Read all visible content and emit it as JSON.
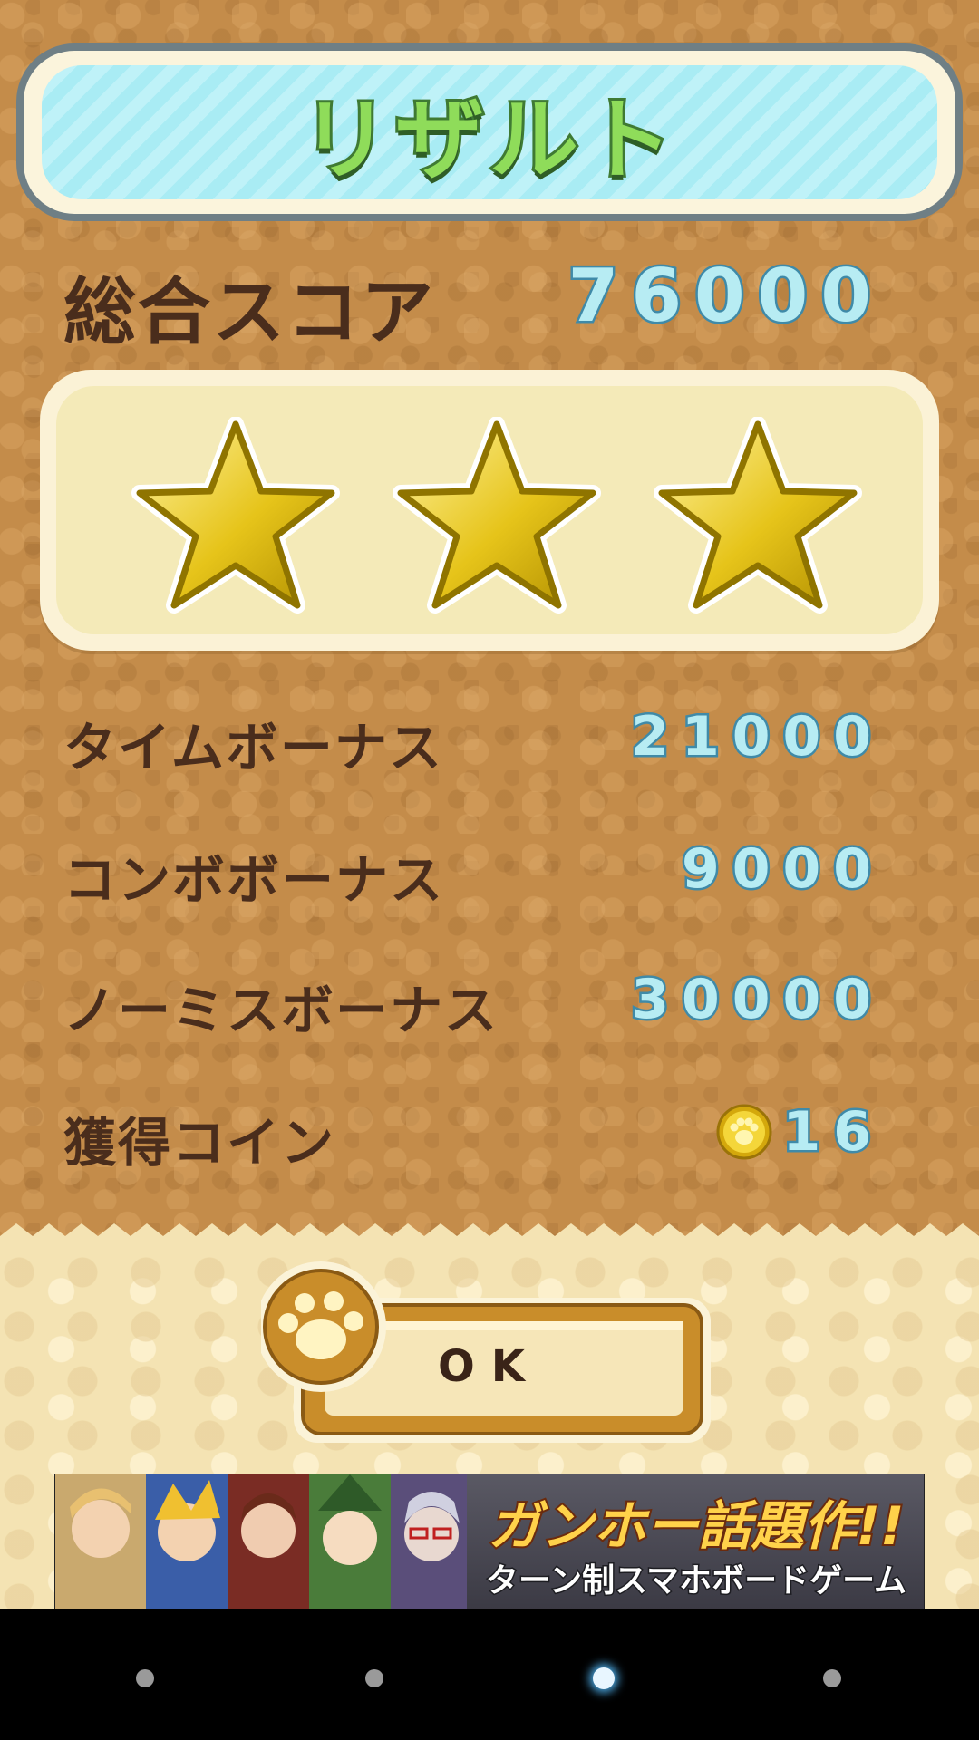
{
  "title": "リザルト",
  "total_score": {
    "label": "総合スコア",
    "value": "76000"
  },
  "stars": {
    "earned": 3,
    "total": 3
  },
  "bonuses": [
    {
      "label": "タイムボーナス",
      "value": "21000"
    },
    {
      "label": "コンボボーナス",
      "value": "9000"
    },
    {
      "label": "ノーミスボーナス",
      "value": "30000"
    }
  ],
  "coins": {
    "label": "獲得コイン",
    "value": "16",
    "icon": "paw-coin-icon"
  },
  "ok_button": {
    "label": "OK",
    "icon": "paw-icon"
  },
  "ad": {
    "headline": "ガンホー話題作!!",
    "subline": "ターン制スマホボードゲーム"
  },
  "nav": {
    "dots": 4,
    "active_index": 2
  },
  "colors": {
    "label_brown": "#4a2d1c",
    "value_fill": "#b7ecf3",
    "value_stroke": "#3f8aa8",
    "title_green": "#8fdc5a",
    "star_gold": "#e6c41a"
  }
}
